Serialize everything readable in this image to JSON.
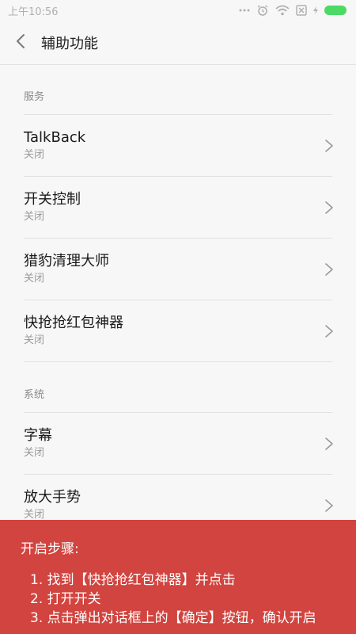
{
  "statusbar": {
    "time": "上午10:56"
  },
  "header": {
    "title": "辅助功能"
  },
  "sections": [
    {
      "header": "服务",
      "items": [
        {
          "title": "TalkBack",
          "status": "关闭"
        },
        {
          "title": "开关控制",
          "status": "关闭"
        },
        {
          "title": "猎豹清理大师",
          "status": "关闭"
        },
        {
          "title": "快抢抢红包神器",
          "status": "关闭"
        }
      ]
    },
    {
      "header": "系统",
      "items": [
        {
          "title": "字幕",
          "status": "关闭"
        },
        {
          "title": "放大手势",
          "status": "关闭"
        }
      ]
    }
  ],
  "guide": {
    "title": "开启步骤:",
    "steps": [
      "1. 找到【快抢抢红包神器】并点击",
      "2. 打开开关",
      "3. 点击弹出对话框上的【确定】按钮，确认开启"
    ]
  },
  "colors": {
    "guide_bg": "#d2443f",
    "battery": "#4cd964",
    "background": "#f7f7f7"
  }
}
